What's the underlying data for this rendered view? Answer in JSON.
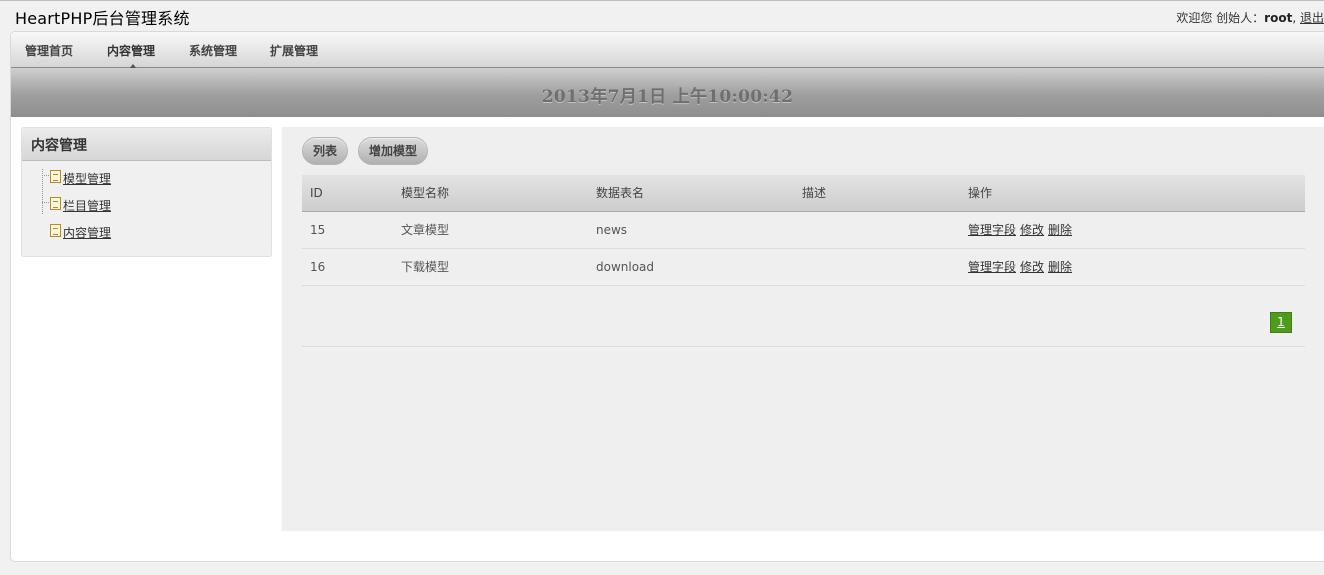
{
  "header": {
    "app_title": "HeartPHP后台管理系统",
    "welcome": "欢迎您 创始人：",
    "username": "root",
    "separator": ",",
    "logout": "退出"
  },
  "nav": {
    "items": [
      {
        "label": "管理首页"
      },
      {
        "label": "内容管理"
      },
      {
        "label": "系统管理"
      },
      {
        "label": "扩展管理"
      }
    ],
    "active": "内容管理"
  },
  "datebar": {
    "datetime": "2013年7月1日 上午10:00:42"
  },
  "sidebar": {
    "title": "内容管理",
    "items": [
      {
        "label": "模型管理"
      },
      {
        "label": "栏目管理"
      },
      {
        "label": "内容管理"
      }
    ]
  },
  "toolbar": {
    "list_label": "列表",
    "add_label": "增加模型"
  },
  "table": {
    "headers": [
      "ID",
      "模型名称",
      "数据表名",
      "描述",
      "操作"
    ],
    "rows": [
      {
        "id": "15",
        "name": "文章模型",
        "table": "news",
        "desc": "",
        "actions": [
          "管理字段",
          "修改",
          "删除"
        ]
      },
      {
        "id": "16",
        "name": "下载模型",
        "table": "download",
        "desc": "",
        "actions": [
          "管理字段",
          "修改",
          "删除"
        ]
      }
    ]
  },
  "pagination": {
    "current": "1"
  },
  "colors": {
    "accent_green": "#4f9b1c",
    "nav_gradient": "#d6d6d6",
    "datebar_gradient": "#9f9f9f"
  },
  "icons": [
    "page-icon",
    "nav-active-arrow-icon"
  ]
}
